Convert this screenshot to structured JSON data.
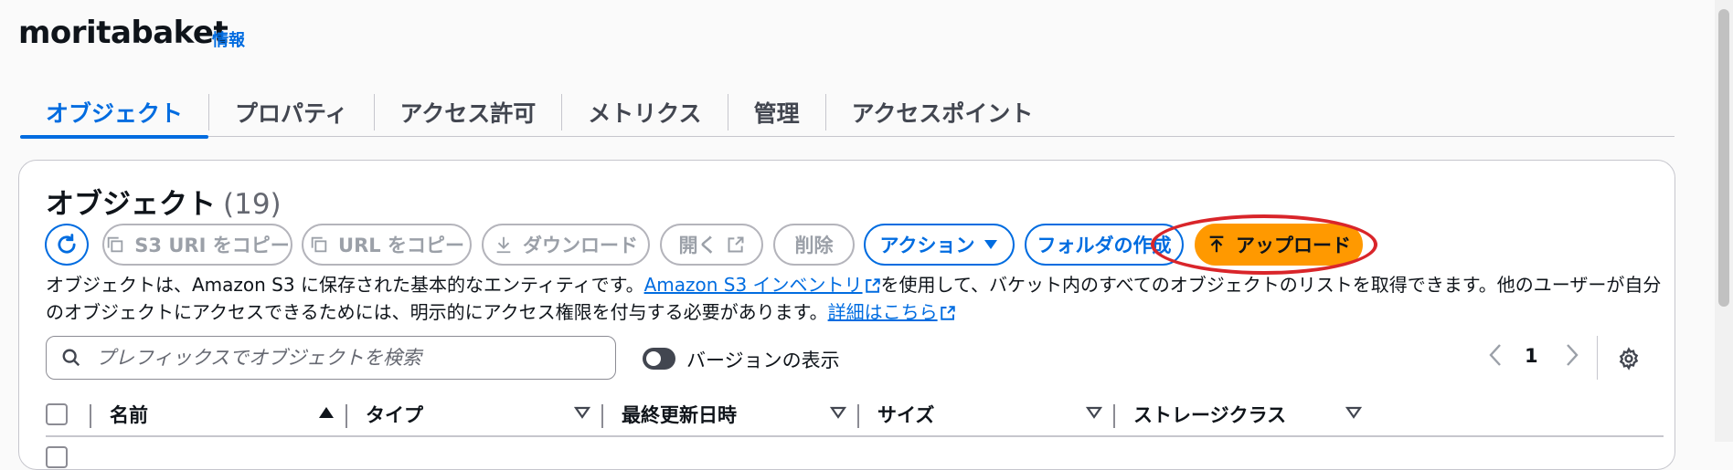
{
  "bucket": {
    "name": "moritabaket",
    "info_label": "情報"
  },
  "tabs": [
    {
      "label": "オブジェクト",
      "active": true
    },
    {
      "label": "プロパティ"
    },
    {
      "label": "アクセス許可"
    },
    {
      "label": "メトリクス"
    },
    {
      "label": "管理"
    },
    {
      "label": "アクセスポイント"
    }
  ],
  "objects": {
    "title": "オブジェクト",
    "count": "(19)",
    "buttons": {
      "copy_s3_uri": "S3 URI をコピー",
      "copy_url": "URL をコピー",
      "download": "ダウンロード",
      "open": "開く",
      "delete": "削除",
      "actions": "アクション",
      "create_folder": "フォルダの作成",
      "upload": "アップロード"
    },
    "description": {
      "text1": "オブジェクトは、Amazon S3 に保存された基本的なエンティティです。",
      "link1": "Amazon S3 インベントリ",
      "text2": "を使用して、バケット内のすべてのオブジェクトのリストを取得できます。他のユーザーが自分のオブジェクトにアクセスできるためには、明示的にアクセス権限を付与する必要があります。",
      "link2": "詳細はこちら"
    },
    "search": {
      "placeholder": "プレフィックスでオブジェクトを検索",
      "value": ""
    },
    "toggle": {
      "label": "バージョンの表示",
      "on": false
    },
    "pagination": {
      "current_page": "1"
    },
    "columns": [
      "名前",
      "タイプ",
      "最終更新日時",
      "サイズ",
      "ストレージクラス"
    ]
  },
  "colors": {
    "accent": "#006ce0",
    "upload": "#ff9900",
    "highlight": "#d9252a"
  },
  "icons": [
    "refresh-icon",
    "copy-icon",
    "download-icon",
    "external-link-icon",
    "caret-down-icon",
    "upload-icon",
    "search-icon",
    "chevron-left-icon",
    "chevron-right-icon",
    "gear-icon",
    "sort-asc-icon",
    "sort-icon"
  ]
}
